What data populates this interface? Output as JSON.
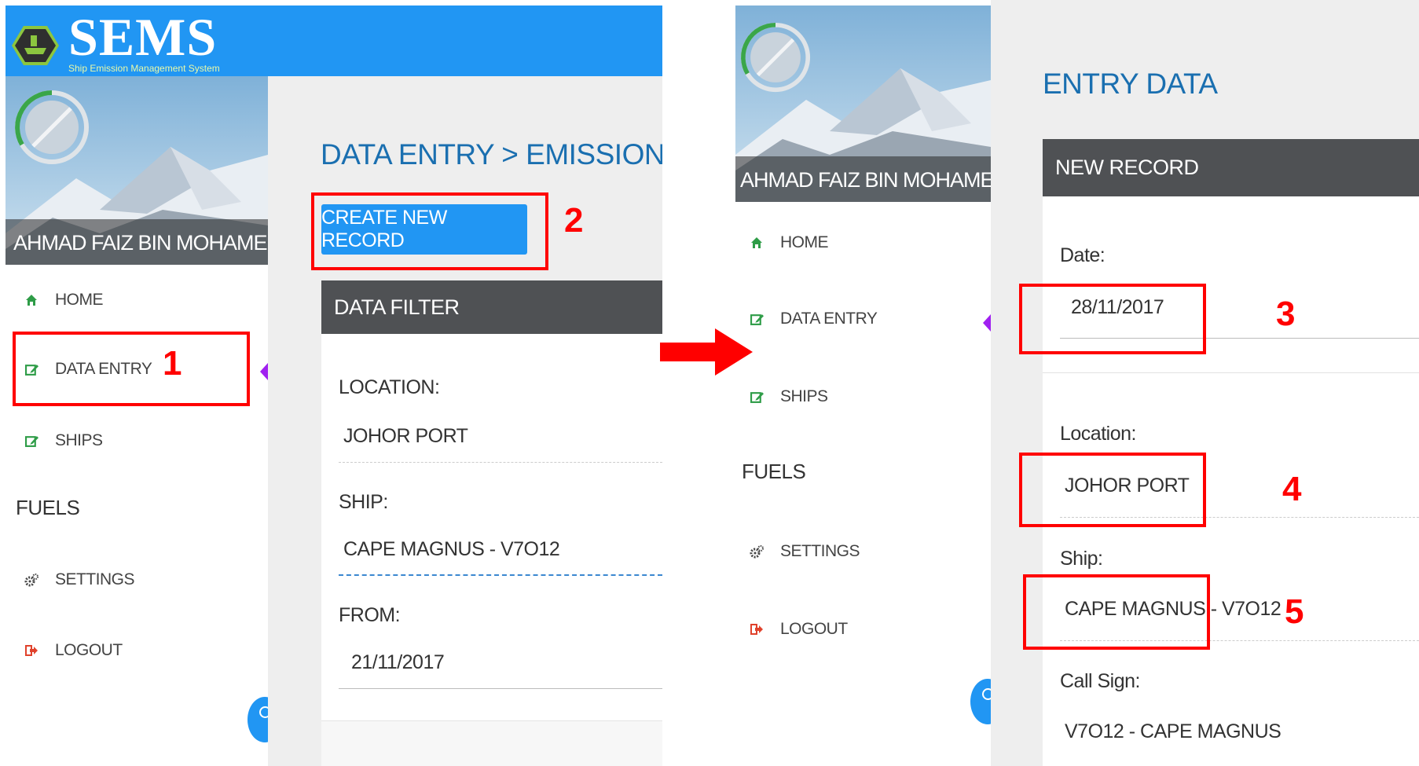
{
  "app": {
    "title": "SEMS",
    "subtitle": "Ship Emission Management System"
  },
  "user": {
    "name": "AHMAD FAIZ BIN MOHAMED"
  },
  "nav": {
    "home": "HOME",
    "data_entry": "DATA ENTRY",
    "ships": "SHIPS",
    "fuels": "FUELS",
    "settings": "SETTINGS",
    "logout": "LOGOUT"
  },
  "left_screen": {
    "breadcrumb": "DATA ENTRY > EMISSION",
    "create_button": "CREATE NEW RECORD",
    "filter": {
      "title": "DATA FILTER",
      "location_label": "LOCATION:",
      "location_value": "JOHOR PORT",
      "ship_label": "SHIP:",
      "ship_value": "CAPE MAGNUS - V7O12",
      "from_label": "FROM:",
      "from_value": "21/11/2017"
    }
  },
  "right_screen": {
    "title": "ENTRY DATA",
    "card_title": "NEW RECORD",
    "date_label": "Date:",
    "date_value": "28/11/2017",
    "location_label": "Location:",
    "location_value": "JOHOR PORT",
    "ship_label": "Ship:",
    "ship_value": "CAPE MAGNUS - V7O12",
    "callsign_label": "Call Sign:",
    "callsign_value": "V7O12 - CAPE MAGNUS"
  },
  "steps": [
    "1",
    "2",
    "3",
    "4",
    "5"
  ],
  "colors": {
    "primary": "#2196f3",
    "title_blue": "#1a6fb0",
    "card_header": "#4f5154",
    "highlight": "#ff0000",
    "nav_icon_green": "#2e9c47",
    "logout_icon": "#e0422c"
  },
  "icons": {
    "home": "home-icon",
    "data_entry": "edit-icon",
    "ships": "edit-icon",
    "settings": "gears-icon",
    "logout": "sign-out-icon"
  }
}
